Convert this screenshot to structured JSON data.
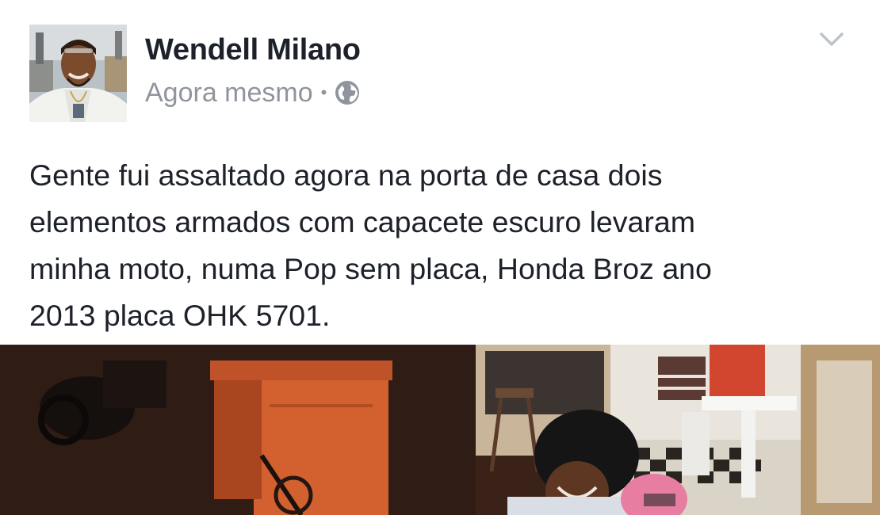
{
  "post": {
    "author": "Wendell Milano",
    "timestamp": "Agora mesmo",
    "separator": "•",
    "audience_icon": "globe-icon",
    "menu_icon": "chevron-down-icon",
    "text": "Gente fui assaltado agora na porta de casa dois\nelementos armados com capacete escuro levaram\nminha moto, numa Pop sem placa,  Honda Broz ano\n2013 placa OHK 5701."
  },
  "colors": {
    "name": "#1d2129",
    "meta": "#90949c",
    "chevron": "#bec3c9"
  }
}
